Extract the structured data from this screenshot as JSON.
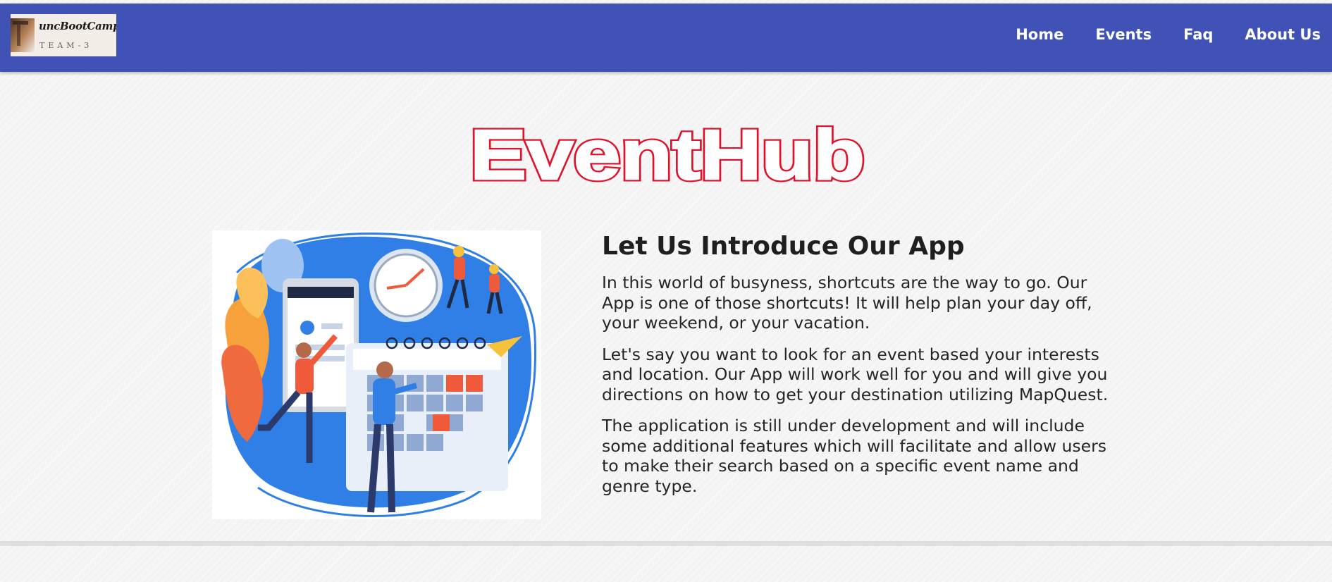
{
  "header": {
    "logo": {
      "brand": "uncBootCamp",
      "subtitle": "TEAM-3"
    },
    "nav": [
      {
        "label": "Home"
      },
      {
        "label": "Events"
      },
      {
        "label": "Faq"
      },
      {
        "label": "About Us"
      }
    ],
    "background_color": "#4052b5"
  },
  "hero": {
    "title": "EventHub",
    "title_color": "#e0112b"
  },
  "intro": {
    "heading": "Let Us Introduce Our App",
    "paragraphs": [
      "In this world of busyness, shortcuts are the way to go. Our App is one of those shortcuts! It will help plan your day off, your weekend, or your vacation.",
      "Let's say you want to look for an event based your interests and location. Our App will work well for you and will give you directions on how to get your destination utilizing MapQuest.",
      "The application is still under development and will include some additional features which will facilitate and allow users to make their search based on a specific event name and genre type."
    ]
  }
}
